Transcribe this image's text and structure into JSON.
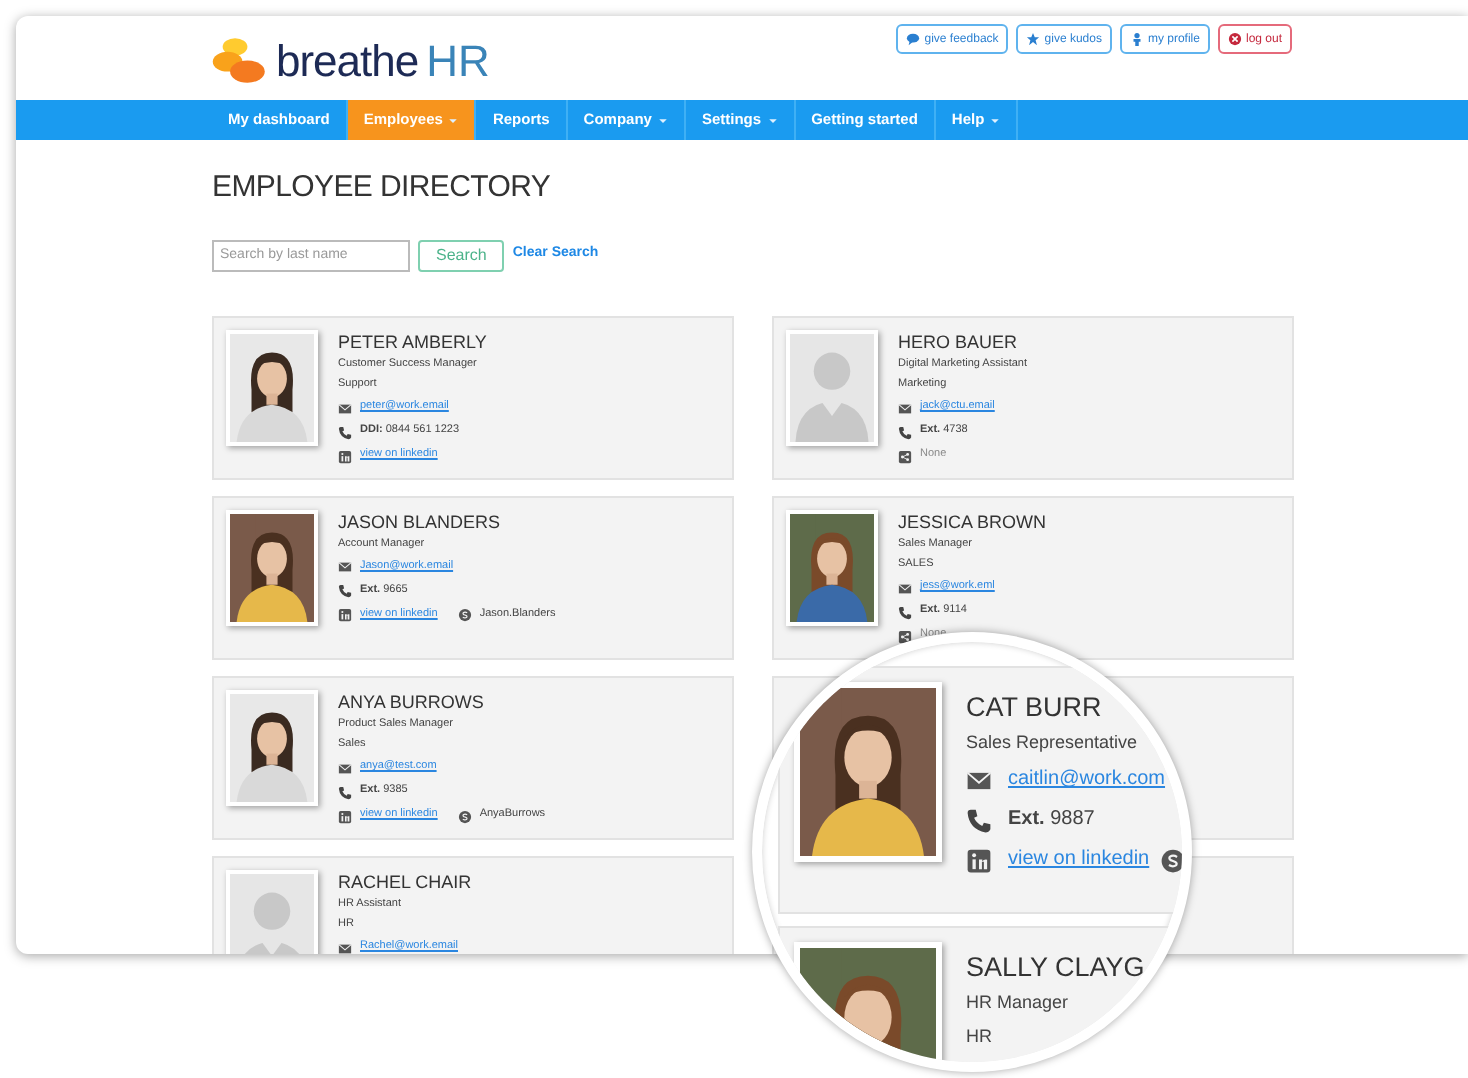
{
  "header": {
    "logo": {
      "name": "breathe",
      "suffix": "HR"
    },
    "actions": [
      {
        "kind": "feedback",
        "label": "give feedback"
      },
      {
        "kind": "kudos",
        "label": "give kudos"
      },
      {
        "kind": "profile",
        "label": "my profile"
      },
      {
        "kind": "logout",
        "label": "log out"
      }
    ]
  },
  "nav": [
    {
      "label": "My dashboard",
      "selected": false,
      "dropdown": false
    },
    {
      "label": "Employees",
      "selected": true,
      "dropdown": true
    },
    {
      "label": "Reports",
      "selected": false,
      "dropdown": false
    },
    {
      "label": "Company",
      "selected": false,
      "dropdown": true
    },
    {
      "label": "Settings",
      "selected": false,
      "dropdown": true
    },
    {
      "label": "Getting started",
      "selected": false,
      "dropdown": false
    },
    {
      "label": "Help",
      "selected": false,
      "dropdown": true
    }
  ],
  "page": {
    "title": "EMPLOYEE DIRECTORY",
    "search": {
      "placeholder": "Search by last name",
      "button": "Search",
      "clear": "Clear Search"
    }
  },
  "cards": [
    {
      "kind": "employee",
      "placeholder": false,
      "name": "PETER AMBERLY",
      "role": "Customer Success Manager",
      "department": "Support",
      "lines": [
        [
          {
            "kind": "email",
            "text": "peter@work.email"
          }
        ],
        [
          {
            "kind": "phone",
            "label": "DDI:",
            "text": "0844 561 1223"
          }
        ],
        [
          {
            "kind": "linkedin",
            "text": "view on linkedin"
          }
        ]
      ]
    },
    {
      "kind": "employee",
      "placeholder": true,
      "name": "HERO BAUER",
      "role": "Digital Marketing Assistant",
      "department": "Marketing",
      "lines": [
        [
          {
            "kind": "email",
            "text": "jack@ctu.email"
          }
        ],
        [
          {
            "kind": "phone",
            "label": "Ext.",
            "text": "4738"
          }
        ],
        [
          {
            "kind": "share",
            "text": "None"
          }
        ]
      ]
    },
    {
      "kind": "employee",
      "placeholder": false,
      "name": "JASON BLANDERS",
      "role": "Account Manager",
      "lines": [
        [
          {
            "kind": "email",
            "text": "Jason@work.email"
          }
        ],
        [
          {
            "kind": "phone",
            "label": "Ext.",
            "text": "9665"
          }
        ],
        [
          {
            "kind": "linkedin",
            "text": "view on linkedin"
          },
          {
            "kind": "skype",
            "text": "Jason.Blanders"
          }
        ]
      ]
    },
    {
      "kind": "employee",
      "placeholder": false,
      "name": "JESSICA BROWN",
      "role": "Sales Manager",
      "department": "SALES",
      "lines": [
        [
          {
            "kind": "email",
            "text": "jess@work.eml"
          }
        ],
        [
          {
            "kind": "phone",
            "label": "Ext.",
            "text": "9114"
          }
        ],
        [
          {
            "kind": "share",
            "text": "None"
          }
        ]
      ]
    },
    {
      "kind": "employee",
      "placeholder": false,
      "name": "ANYA BURROWS",
      "role": "Product Sales Manager",
      "department": "Sales",
      "lines": [
        [
          {
            "kind": "email",
            "text": "anya@test.com"
          }
        ],
        [
          {
            "kind": "phone",
            "label": "Ext.",
            "text": "9385"
          }
        ],
        [
          {
            "kind": "linkedin",
            "text": "view on linkedin"
          },
          {
            "kind": "skype",
            "text": "AnyaBurrows"
          }
        ]
      ]
    },
    {
      "kind": "covered"
    },
    {
      "kind": "employee",
      "placeholder": true,
      "name": "RACHEL CHAIR",
      "role": "HR Assistant",
      "department": "HR",
      "lines": [
        [
          {
            "kind": "email",
            "text": "Rachel@work.email"
          }
        ]
      ]
    },
    {
      "kind": "covered"
    }
  ],
  "magnifier": {
    "cards": [
      {
        "kind": "employee",
        "placeholder": false,
        "name": "CAT BURR",
        "role": "Sales Representative",
        "lines": [
          [
            {
              "kind": "email",
              "text": "caitlin@work.com"
            }
          ],
          [
            {
              "kind": "phone",
              "label": "Ext.",
              "text": "9887"
            }
          ],
          [
            {
              "kind": "linkedin",
              "text": "view on linkedin"
            },
            {
              "kind": "skype"
            }
          ]
        ]
      },
      {
        "kind": "employee",
        "placeholder": false,
        "name": "SALLY CLAYG",
        "role": "HR Manager",
        "department": "HR"
      }
    ]
  }
}
